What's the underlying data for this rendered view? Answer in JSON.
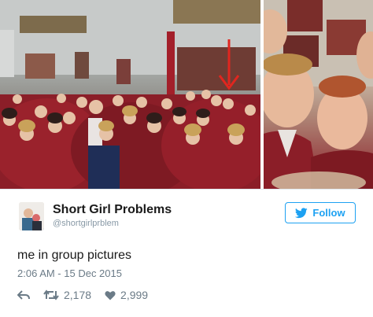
{
  "tweet": {
    "name": "Short Girl Problems",
    "handle": "@shortgirlprblem",
    "text": "me in group pictures",
    "timestamp": "2:06 AM - 15 Dec 2015",
    "retweet_count": "2,178",
    "like_count": "2,999"
  },
  "follow": {
    "label": "Follow",
    "icon": "twitter-bird-icon"
  },
  "icons": {
    "reply": "reply-icon",
    "retweet": "retweet-icon",
    "like": "heart-icon",
    "annotation": "red-arrow-icon"
  },
  "colors": {
    "twitter_blue": "#1da1f2",
    "arrow_red": "#e0261f",
    "muted_gray": "#6b7b87",
    "jacket_red": "#8b1e28"
  }
}
